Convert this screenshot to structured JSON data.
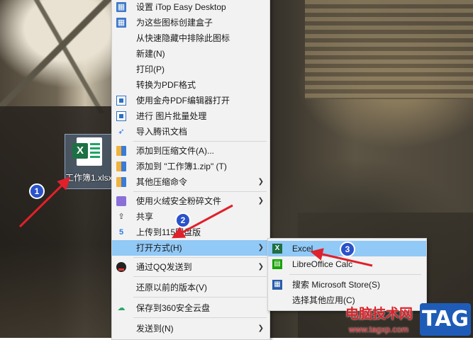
{
  "desktop_file": {
    "label": "工作簿1.xlsx",
    "icon": "excel-file-icon"
  },
  "context_menu": {
    "items": [
      {
        "label": "设置 iTop Easy Desktop",
        "icon": "itop-icon",
        "submenu": false
      },
      {
        "label": "为这些图标创建盒子",
        "icon": "itop-box-icon",
        "submenu": false
      },
      {
        "label": "从快速隐藏中排除此图标",
        "icon": "",
        "submenu": false
      },
      {
        "label": "新建(N)",
        "icon": "",
        "submenu": false
      },
      {
        "label": "打印(P)",
        "icon": "",
        "submenu": false
      },
      {
        "label": "转换为PDF格式",
        "icon": "",
        "submenu": false
      },
      {
        "label": "使用金舟PDF编辑器打开",
        "icon": "pdf-editor-icon",
        "submenu": false
      },
      {
        "label": "进行 图片批量处理",
        "icon": "batch-image-icon",
        "submenu": false
      },
      {
        "label": "导入腾讯文档",
        "icon": "tencent-docs-icon",
        "submenu": false
      },
      {
        "label": "添加到压缩文件(A)...",
        "icon": "archive-icon",
        "submenu": false
      },
      {
        "label": "添加到 \"工作簿1.zip\" (T)",
        "icon": "archive-icon",
        "submenu": false
      },
      {
        "label": "其他压缩命令",
        "icon": "archive-icon",
        "submenu": true
      },
      {
        "label": "使用火绒安全粉碎文件",
        "icon": "shredder-icon",
        "submenu": true
      },
      {
        "label": "共享",
        "icon": "share-icon",
        "submenu": false
      },
      {
        "label": "上传到115网盘版",
        "icon": "cloud-115-icon",
        "submenu": false
      },
      {
        "label": "打开方式(H)",
        "icon": "",
        "submenu": true,
        "active": true
      },
      {
        "label": "通过QQ发送到",
        "icon": "qq-icon",
        "submenu": true
      },
      {
        "label": "还原以前的版本(V)",
        "icon": "",
        "submenu": false
      },
      {
        "label": "保存到360安全云盘",
        "icon": "cloud-360-icon",
        "submenu": false
      },
      {
        "label": "发送到(N)",
        "icon": "",
        "submenu": true
      }
    ]
  },
  "open_with_submenu": {
    "items": [
      {
        "label": "Excel",
        "icon": "excel-icon",
        "active": true
      },
      {
        "label": "LibreOffice Calc",
        "icon": "libreoffice-calc-icon"
      },
      {
        "label": "搜索 Microsoft Store(S)",
        "icon": "microsoft-store-icon"
      },
      {
        "label": "选择其他应用(C)",
        "icon": ""
      }
    ]
  },
  "markers": [
    "1",
    "2",
    "3"
  ],
  "watermark": {
    "site_name": "电脑技术网",
    "url": "www.tagxp.com",
    "logo": "TAG"
  },
  "colors": {
    "highlight": "#91c9f7",
    "marker": "#2a52c9",
    "arrow": "#e0202a",
    "watermark": "#d8232a"
  }
}
